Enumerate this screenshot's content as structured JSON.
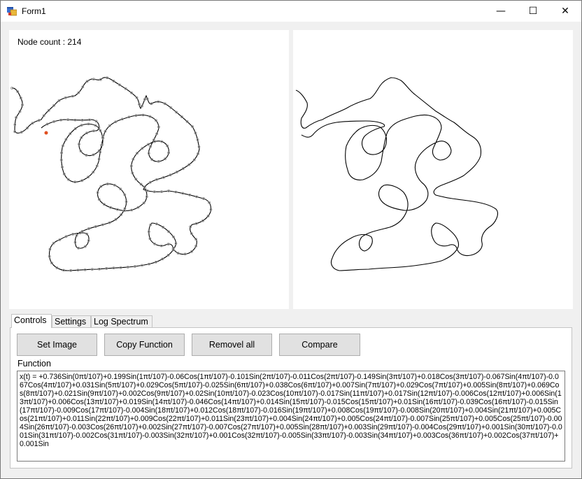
{
  "window": {
    "title": "Form1",
    "controls": {
      "minimize": "—",
      "maximize": "☐",
      "close": "✕"
    }
  },
  "left_panel": {
    "node_count": "Node count : 214"
  },
  "tabs": [
    {
      "label": "Controls",
      "active": true
    },
    {
      "label": "Settings",
      "active": false
    },
    {
      "label": "Log Spectrum",
      "active": false
    }
  ],
  "buttons": {
    "set_image": "Set Image",
    "copy_function": "Copy Function",
    "remove_all": "Removel all",
    "compare": "Compare"
  },
  "function": {
    "label": "Function",
    "text": "x(t) = +0.736Sin(0πt/107)+0.199Sin(1πt/107)-0.06Cos(1πt/107)-0.101Sin(2πt/107)-0.011Cos(2πt/107)-0.149Sin(3πt/107)+0.018Cos(3πt/107)-0.067Sin(4πt/107)-0.067Cos(4πt/107)+0.031Sin(5πt/107)+0.029Cos(5πt/107)-0.025Sin(6πt/107)+0.038Cos(6πt/107)+0.007Sin(7πt/107)+0.029Cos(7πt/107)+0.005Sin(8πt/107)+0.069Cos(8πt/107)+0.021Sin(9πt/107)+0.002Cos(9πt/107)+0.02Sin(10πt/107)-0.023Cos(10πt/107)-0.017Sin(11πt/107)+0.017Sin(12πt/107)-0.006Cos(12πt/107)+0.006Sin(13πt/107)+0.006Cos(13πt/107)+0.019Sin(14πt/107)-0.046Cos(14πt/107)+0.014Sin(15πt/107)-0.015Cos(15πt/107)+0.01Sin(16πt/107)-0.039Cos(16πt/107)-0.015Sin(17πt/107)-0.009Cos(17πt/107)-0.004Sin(18πt/107)+0.012Cos(18πt/107)-0.016Sin(19πt/107)+0.008Cos(19πt/107)-0.008Sin(20πt/107)+0.004Sin(21πt/107)+0.005Cos(21πt/107)+0.011Sin(22πt/107)+0.009Cos(22πt/107)+0.011Sin(23πt/107)+0.004Sin(24πt/107)+0.005Cos(24πt/107)-0.007Sin(25πt/107)+0.005Cos(25πt/107)-0.004Sin(26πt/107)-0.003Cos(26πt/107)+0.002Sin(27πt/107)-0.007Cos(27πt/107)+0.005Sin(28πt/107)+0.003Sin(29πt/107)-0.004Cos(29πt/107)+0.001Sin(30πt/107)-0.001Sin(31πt/107)-0.002Cos(31πt/107)-0.003Sin(32πt/107)+0.001Cos(32πt/107)-0.005Sin(33πt/107)-0.003Sin(34πt/107)+0.003Cos(36πt/107)+0.002Cos(37πt/107)+0.001Sin"
  },
  "colors": {
    "background": "#f0f0f0",
    "canvas": "#ffffff",
    "node": "#9a9a9a",
    "selected_node": "#e05020"
  }
}
